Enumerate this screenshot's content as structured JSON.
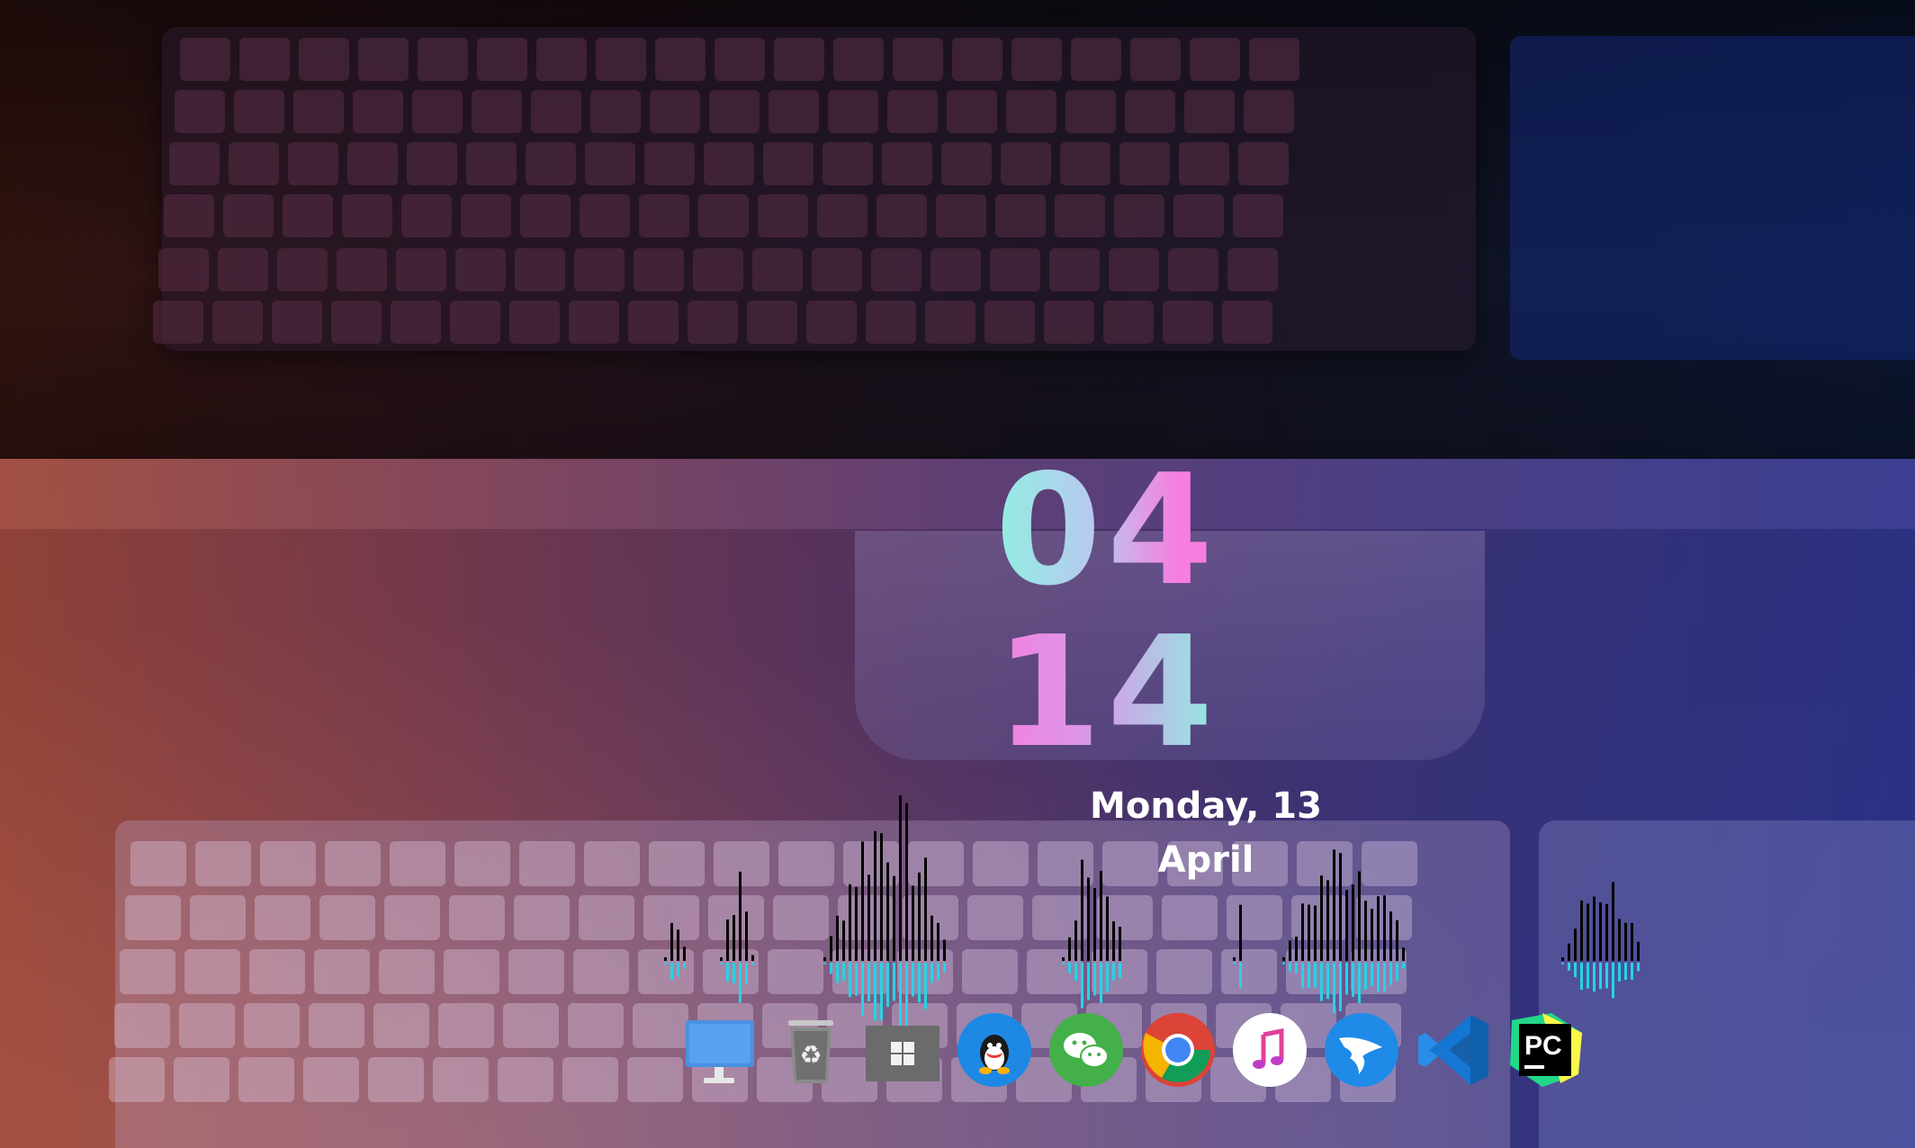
{
  "clock": {
    "hour": "04",
    "minute": "14"
  },
  "date": {
    "line1": "Monday, 13",
    "line2": "April"
  },
  "audio_visualizer": {
    "bar_color_top": "#000000",
    "bar_color_bottom": "#27d3e6"
  },
  "dock": {
    "items": [
      {
        "name": "this-pc-icon"
      },
      {
        "name": "recycle-bin-icon"
      },
      {
        "name": "control-panel-icon"
      },
      {
        "name": "qq-icon"
      },
      {
        "name": "wechat-icon"
      },
      {
        "name": "chrome-icon"
      },
      {
        "name": "itunes-icon"
      },
      {
        "name": "feishu-icon"
      },
      {
        "name": "vscode-icon"
      },
      {
        "name": "pycharm-icon",
        "text": "PC"
      }
    ]
  },
  "colors": {
    "clock_cyan": "#8ff0e0",
    "clock_pink": "#f77ee0",
    "date_text": "#ffffff"
  }
}
